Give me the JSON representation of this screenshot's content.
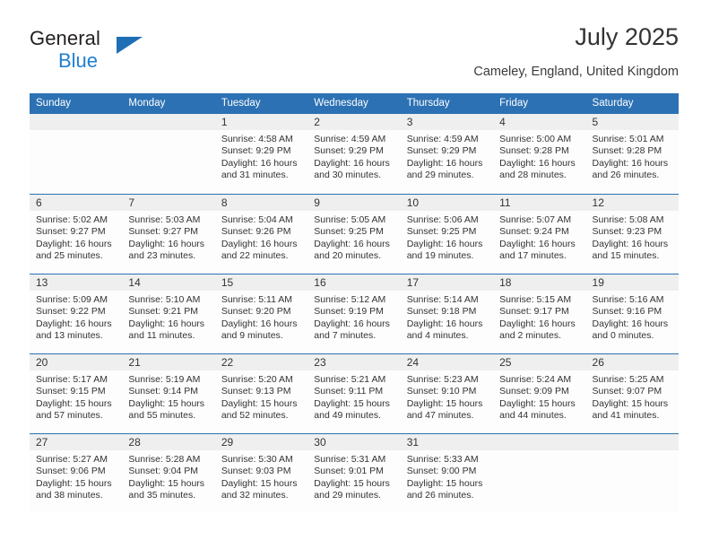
{
  "brand": {
    "name_part1": "General",
    "name_part2": "Blue",
    "triangle_color": "#1f6fb5",
    "blue_text_color": "#1f7fd0"
  },
  "header": {
    "title": "July 2025",
    "subtitle": "Cameley, England, United Kingdom"
  },
  "theme": {
    "header_blue": "#2c71b3",
    "day_band_gray": "#efefef",
    "cell_background": "#fdfdfd",
    "text_color": "#333333"
  },
  "weekdays": [
    "Sunday",
    "Monday",
    "Tuesday",
    "Wednesday",
    "Thursday",
    "Friday",
    "Saturday"
  ],
  "weeks": [
    [
      {
        "day": "",
        "lines": [],
        "empty": true
      },
      {
        "day": "",
        "lines": [],
        "empty": true
      },
      {
        "day": "1",
        "lines": [
          "Sunrise: 4:58 AM",
          "Sunset: 9:29 PM",
          "Daylight: 16 hours",
          "and 31 minutes."
        ],
        "empty": false
      },
      {
        "day": "2",
        "lines": [
          "Sunrise: 4:59 AM",
          "Sunset: 9:29 PM",
          "Daylight: 16 hours",
          "and 30 minutes."
        ],
        "empty": false
      },
      {
        "day": "3",
        "lines": [
          "Sunrise: 4:59 AM",
          "Sunset: 9:29 PM",
          "Daylight: 16 hours",
          "and 29 minutes."
        ],
        "empty": false
      },
      {
        "day": "4",
        "lines": [
          "Sunrise: 5:00 AM",
          "Sunset: 9:28 PM",
          "Daylight: 16 hours",
          "and 28 minutes."
        ],
        "empty": false
      },
      {
        "day": "5",
        "lines": [
          "Sunrise: 5:01 AM",
          "Sunset: 9:28 PM",
          "Daylight: 16 hours",
          "and 26 minutes."
        ],
        "empty": false
      }
    ],
    [
      {
        "day": "6",
        "lines": [
          "Sunrise: 5:02 AM",
          "Sunset: 9:27 PM",
          "Daylight: 16 hours",
          "and 25 minutes."
        ],
        "empty": false
      },
      {
        "day": "7",
        "lines": [
          "Sunrise: 5:03 AM",
          "Sunset: 9:27 PM",
          "Daylight: 16 hours",
          "and 23 minutes."
        ],
        "empty": false
      },
      {
        "day": "8",
        "lines": [
          "Sunrise: 5:04 AM",
          "Sunset: 9:26 PM",
          "Daylight: 16 hours",
          "and 22 minutes."
        ],
        "empty": false
      },
      {
        "day": "9",
        "lines": [
          "Sunrise: 5:05 AM",
          "Sunset: 9:25 PM",
          "Daylight: 16 hours",
          "and 20 minutes."
        ],
        "empty": false
      },
      {
        "day": "10",
        "lines": [
          "Sunrise: 5:06 AM",
          "Sunset: 9:25 PM",
          "Daylight: 16 hours",
          "and 19 minutes."
        ],
        "empty": false
      },
      {
        "day": "11",
        "lines": [
          "Sunrise: 5:07 AM",
          "Sunset: 9:24 PM",
          "Daylight: 16 hours",
          "and 17 minutes."
        ],
        "empty": false
      },
      {
        "day": "12",
        "lines": [
          "Sunrise: 5:08 AM",
          "Sunset: 9:23 PM",
          "Daylight: 16 hours",
          "and 15 minutes."
        ],
        "empty": false
      }
    ],
    [
      {
        "day": "13",
        "lines": [
          "Sunrise: 5:09 AM",
          "Sunset: 9:22 PM",
          "Daylight: 16 hours",
          "and 13 minutes."
        ],
        "empty": false
      },
      {
        "day": "14",
        "lines": [
          "Sunrise: 5:10 AM",
          "Sunset: 9:21 PM",
          "Daylight: 16 hours",
          "and 11 minutes."
        ],
        "empty": false
      },
      {
        "day": "15",
        "lines": [
          "Sunrise: 5:11 AM",
          "Sunset: 9:20 PM",
          "Daylight: 16 hours",
          "and 9 minutes."
        ],
        "empty": false
      },
      {
        "day": "16",
        "lines": [
          "Sunrise: 5:12 AM",
          "Sunset: 9:19 PM",
          "Daylight: 16 hours",
          "and 7 minutes."
        ],
        "empty": false
      },
      {
        "day": "17",
        "lines": [
          "Sunrise: 5:14 AM",
          "Sunset: 9:18 PM",
          "Daylight: 16 hours",
          "and 4 minutes."
        ],
        "empty": false
      },
      {
        "day": "18",
        "lines": [
          "Sunrise: 5:15 AM",
          "Sunset: 9:17 PM",
          "Daylight: 16 hours",
          "and 2 minutes."
        ],
        "empty": false
      },
      {
        "day": "19",
        "lines": [
          "Sunrise: 5:16 AM",
          "Sunset: 9:16 PM",
          "Daylight: 16 hours",
          "and 0 minutes."
        ],
        "empty": false
      }
    ],
    [
      {
        "day": "20",
        "lines": [
          "Sunrise: 5:17 AM",
          "Sunset: 9:15 PM",
          "Daylight: 15 hours",
          "and 57 minutes."
        ],
        "empty": false
      },
      {
        "day": "21",
        "lines": [
          "Sunrise: 5:19 AM",
          "Sunset: 9:14 PM",
          "Daylight: 15 hours",
          "and 55 minutes."
        ],
        "empty": false
      },
      {
        "day": "22",
        "lines": [
          "Sunrise: 5:20 AM",
          "Sunset: 9:13 PM",
          "Daylight: 15 hours",
          "and 52 minutes."
        ],
        "empty": false
      },
      {
        "day": "23",
        "lines": [
          "Sunrise: 5:21 AM",
          "Sunset: 9:11 PM",
          "Daylight: 15 hours",
          "and 49 minutes."
        ],
        "empty": false
      },
      {
        "day": "24",
        "lines": [
          "Sunrise: 5:23 AM",
          "Sunset: 9:10 PM",
          "Daylight: 15 hours",
          "and 47 minutes."
        ],
        "empty": false
      },
      {
        "day": "25",
        "lines": [
          "Sunrise: 5:24 AM",
          "Sunset: 9:09 PM",
          "Daylight: 15 hours",
          "and 44 minutes."
        ],
        "empty": false
      },
      {
        "day": "26",
        "lines": [
          "Sunrise: 5:25 AM",
          "Sunset: 9:07 PM",
          "Daylight: 15 hours",
          "and 41 minutes."
        ],
        "empty": false
      }
    ],
    [
      {
        "day": "27",
        "lines": [
          "Sunrise: 5:27 AM",
          "Sunset: 9:06 PM",
          "Daylight: 15 hours",
          "and 38 minutes."
        ],
        "empty": false
      },
      {
        "day": "28",
        "lines": [
          "Sunrise: 5:28 AM",
          "Sunset: 9:04 PM",
          "Daylight: 15 hours",
          "and 35 minutes."
        ],
        "empty": false
      },
      {
        "day": "29",
        "lines": [
          "Sunrise: 5:30 AM",
          "Sunset: 9:03 PM",
          "Daylight: 15 hours",
          "and 32 minutes."
        ],
        "empty": false
      },
      {
        "day": "30",
        "lines": [
          "Sunrise: 5:31 AM",
          "Sunset: 9:01 PM",
          "Daylight: 15 hours",
          "and 29 minutes."
        ],
        "empty": false
      },
      {
        "day": "31",
        "lines": [
          "Sunrise: 5:33 AM",
          "Sunset: 9:00 PM",
          "Daylight: 15 hours",
          "and 26 minutes."
        ],
        "empty": false
      },
      {
        "day": "",
        "lines": [],
        "empty": true
      },
      {
        "day": "",
        "lines": [],
        "empty": true
      }
    ]
  ]
}
